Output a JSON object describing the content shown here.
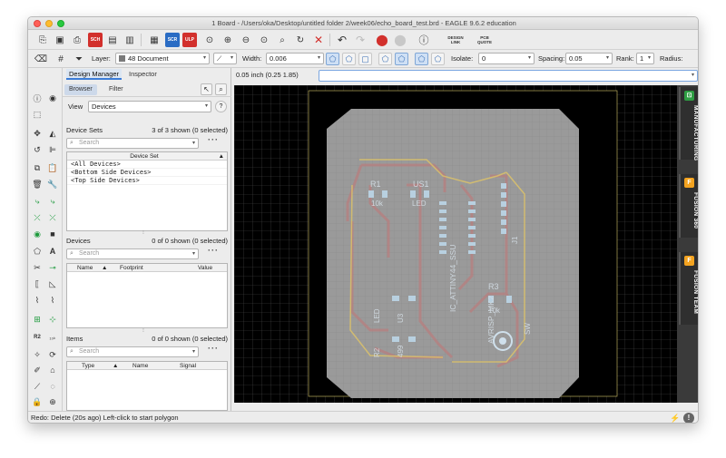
{
  "window": {
    "title": "1 Board - /Users/oka/Desktop/untitled folder 2/week06/echo_board_test.brd - EAGLE 9.6.2 education"
  },
  "toolbar": {
    "scr_label": "SCR",
    "ulp_label": "ULP",
    "sch_label": "SCH",
    "design_link_label": "DESIGN LINK",
    "pcb_quote_label": "PCB QUOTE"
  },
  "params": {
    "layer_label": "Layer:",
    "layer_value": "48 Document",
    "width_label": "Width:",
    "width_value": "0.006",
    "isolate_label": "Isolate:",
    "isolate_value": "0",
    "spacing_label": "Spacing:",
    "spacing_value": "0.05",
    "rank_label": "Rank:",
    "rank_value": "1",
    "radius_label": "Radius:"
  },
  "panel": {
    "tabs": [
      "Design Manager",
      "Inspector"
    ],
    "subtabs": [
      "Browser",
      "Filter"
    ],
    "view_label": "View",
    "view_value": "Devices",
    "device_sets": {
      "title": "Device Sets",
      "count": "3 of 3 shown (0 selected)",
      "search_placeholder": "Search",
      "column": "Device Set",
      "rows": [
        "<All Devices>",
        "<Bottom Side Devices>",
        "<Top Side Devices>"
      ]
    },
    "devices": {
      "title": "Devices",
      "count": "0 of 0 shown (0 selected)",
      "search_placeholder": "Search",
      "columns": [
        "Name",
        "Footprint",
        "Value"
      ]
    },
    "items": {
      "title": "Items",
      "count": "0 of 0 shown (0 selected)",
      "search_placeholder": "Search",
      "columns": [
        "Type",
        "Name",
        "Signal"
      ]
    }
  },
  "canvas": {
    "coordinate": "0.05 inch (0.25 1.85)",
    "labels": {
      "r1": "R1",
      "us1": "US1",
      "r1v": "10k",
      "led1": "LED",
      "ic": "IC_ATTINY44_SSU",
      "avr": "AVRISP_MK2",
      "r3": "R3",
      "r3v": "10k",
      "led2": "LED",
      "u3": "U3",
      "r2": "R2",
      "r2v": "499",
      "sw": "SW",
      "j1": "J1"
    }
  },
  "right_tabs": [
    {
      "label": "MANUFACTURING",
      "color": "#2e9e43",
      "icon": "manufacturing-icon",
      "glyph": "⊡"
    },
    {
      "label": "FUSION 360",
      "color": "#f3a320",
      "icon": "fusion-360-icon",
      "glyph": "F"
    },
    {
      "label": "FUSION TEAM",
      "color": "#f3a320",
      "icon": "fusion-team-icon",
      "glyph": "F"
    }
  ],
  "status": {
    "text": "Redo: Delete (20s ago) Left-click to start polygon"
  }
}
